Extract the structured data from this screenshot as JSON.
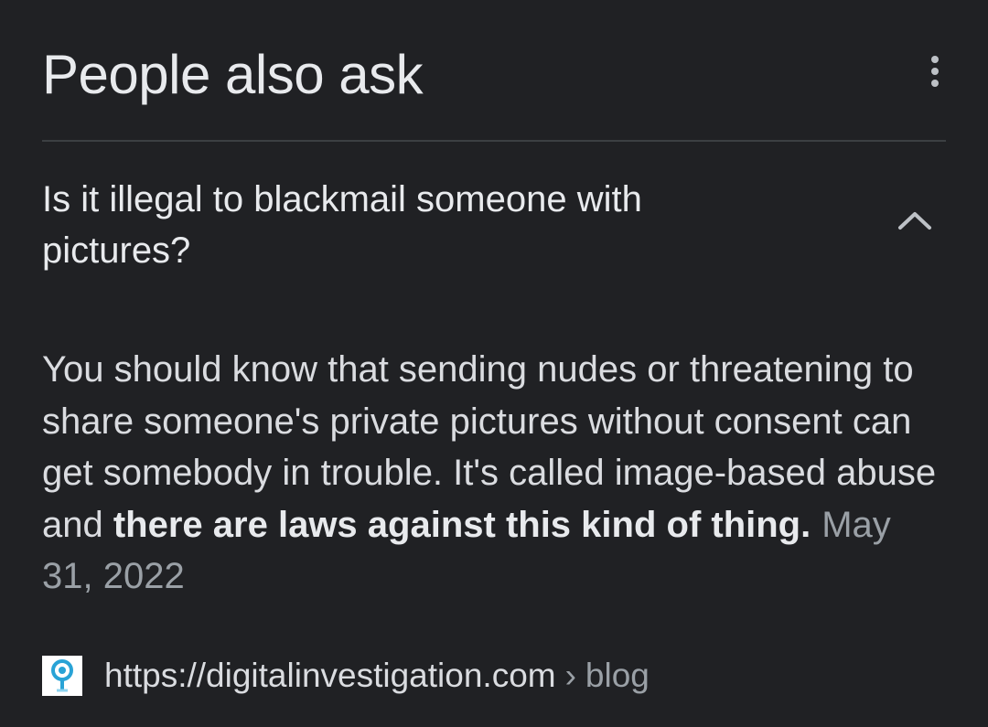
{
  "panel": {
    "title": "People also ask",
    "more_icon": "more-vert-icon"
  },
  "question": {
    "text": "Is it illegal to blackmail someone with pictures?",
    "expanded": true,
    "toggle_icon": "chevron-up-icon"
  },
  "answer": {
    "text_plain": "You should know that sending nudes or threatening to share someone's private pictures without consent can get somebody in trouble. It's called image-based abuse and ",
    "text_bold": "there are laws against this kind of thing.",
    "date": "May 31, 2022"
  },
  "source": {
    "favicon_icon": "site-favicon-icon",
    "url": "https://digitalinvestigation.com",
    "separator": "›",
    "path": "blog"
  },
  "colors": {
    "background": "#202124",
    "text_primary": "#e8eaed",
    "text_secondary": "#9aa0a6",
    "divider": "#3c4043",
    "favicon_accent": "#29a3d6"
  }
}
